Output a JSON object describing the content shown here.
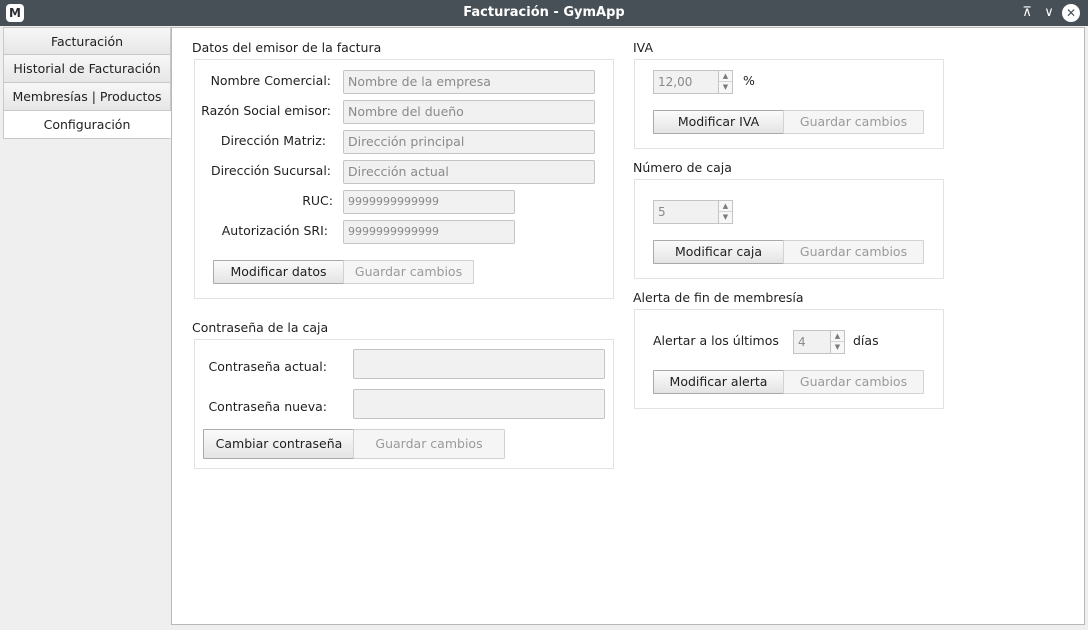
{
  "window": {
    "title": "Facturación - GymApp",
    "logo_letter": "M",
    "icons": {
      "keep_above": "keep-above-icon",
      "minimize": "minimize-icon",
      "close": "close-icon"
    }
  },
  "sidebar": {
    "tabs": [
      {
        "label": "Facturación"
      },
      {
        "label": "Historial de Facturación"
      },
      {
        "label": "Membresías | Productos"
      },
      {
        "label": "Configuración",
        "active": true
      }
    ]
  },
  "issuer": {
    "title": "Datos del emisor de la factura",
    "fields": [
      {
        "label": "Nombre Comercial:",
        "placeholder": "Nombre de la empresa"
      },
      {
        "label": "Razón Social emisor:",
        "placeholder": "Nombre del dueño"
      },
      {
        "label": "Dirección Matriz:",
        "placeholder": "Dirección principal"
      },
      {
        "label": "Dirección Sucursal:",
        "placeholder": "Dirección actual"
      },
      {
        "label": "RUC:",
        "placeholder": "9999999999999"
      },
      {
        "label": "Autorización SRI:",
        "placeholder": "9999999999999"
      }
    ],
    "modify_label": "Modificar datos",
    "save_label": "Guardar cambios"
  },
  "password": {
    "title": "Contraseña de la caja",
    "current_label": "Contraseña actual:",
    "new_label": "Contraseña nueva:",
    "change_label": "Cambiar contraseña",
    "save_label": "Guardar cambios"
  },
  "iva": {
    "title": "IVA",
    "value": "12,00",
    "unit": "%",
    "modify_label": "Modificar IVA",
    "save_label": "Guardar cambios"
  },
  "cashbox": {
    "title": "Número de caja",
    "value": "5",
    "modify_label": "Modificar caja",
    "save_label": "Guardar cambios"
  },
  "alert": {
    "title": "Alerta de fin de membresía",
    "prefix": "Alertar a los últimos",
    "value": "4",
    "suffix": "días",
    "modify_label": "Modificar alerta",
    "save_label": "Guardar cambios"
  },
  "colors": {
    "titlebar": "#475057",
    "content_bg": "#ffffff",
    "disabled_text": "#9a9a9a"
  }
}
